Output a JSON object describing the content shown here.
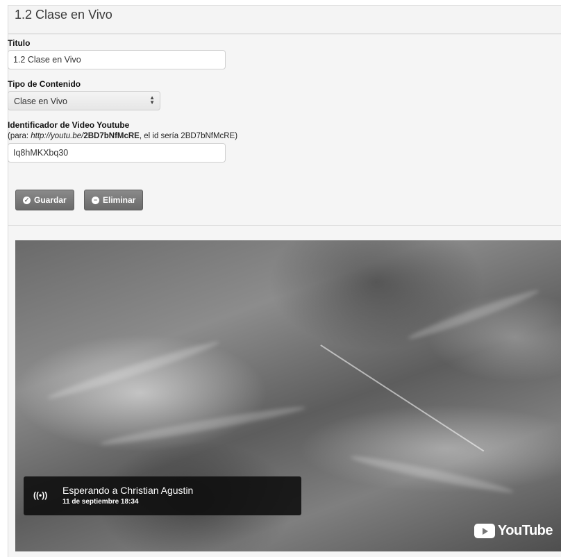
{
  "panel": {
    "title": "1.2 Clase en Vivo"
  },
  "form": {
    "titulo_label": "Titulo",
    "titulo_value": "1.2 Clase en Vivo",
    "tipo_label": "Tipo de Contenido",
    "tipo_value": "Clase en Vivo",
    "youtube_label": "Identificador de Video Youtube",
    "hint_prefix": "(para: ",
    "hint_url": "http://youtu.be/",
    "hint_id_bold": "2BD7bNfMcRE",
    "hint_suffix": ", el id sería 2BD7bNfMcRE)",
    "youtube_value": "Iq8hMKXbq30"
  },
  "buttons": {
    "save_label": "Guardar",
    "delete_label": "Eliminar"
  },
  "video": {
    "live_title": "Esperando a Christian Agustin",
    "live_datetime": "11 de septiembre 18:34",
    "live_icon": "((•))",
    "brand": "YouTube"
  }
}
